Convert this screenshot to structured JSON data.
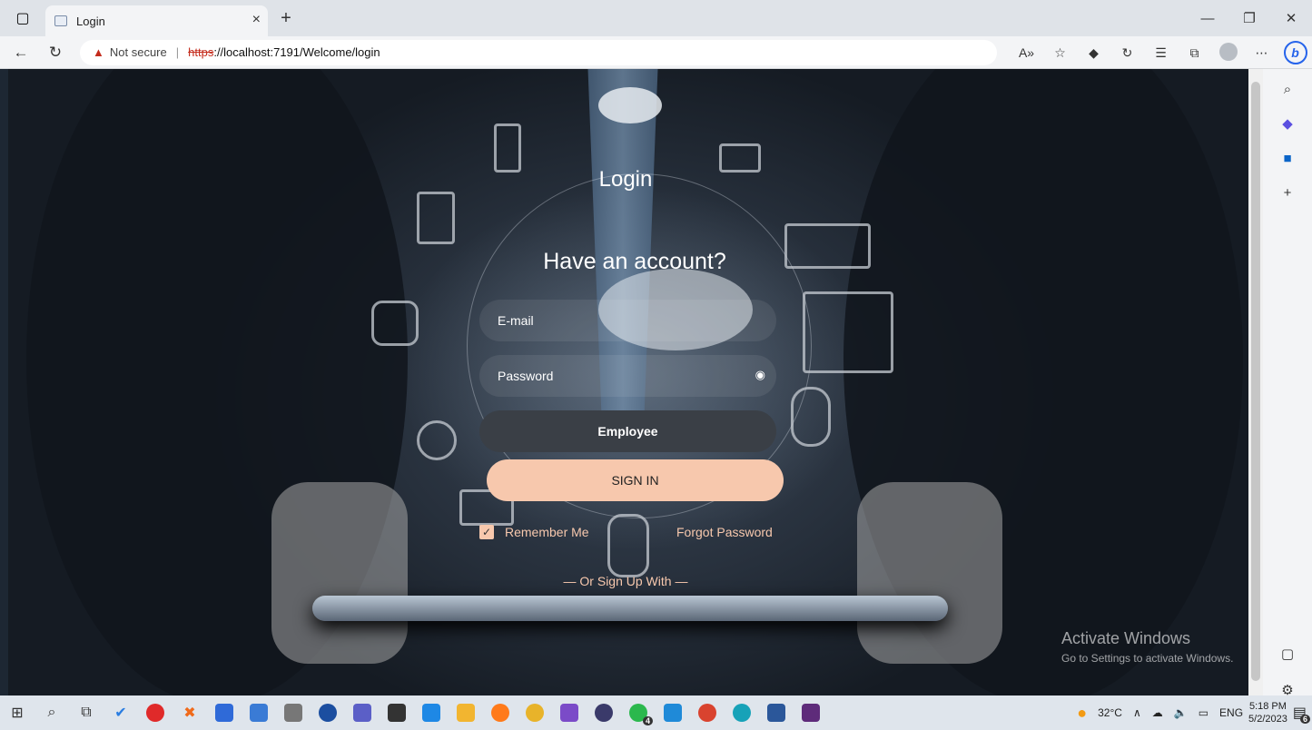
{
  "browser": {
    "tab_title": "Login",
    "new_tab_label": "+",
    "not_secure": "Not secure",
    "url_scheme": "https",
    "url_rest": "://localhost:7191/Welcome/login"
  },
  "login": {
    "title": "Login",
    "subtitle": "Have an account?",
    "email_placeholder": "E-mail",
    "password_placeholder": "Password",
    "role_button": "Employee",
    "sign_in": "SIGN IN",
    "remember_me": "Remember Me",
    "forgot_password": "Forgot Password",
    "or_sign_up": "— Or Sign Up With —"
  },
  "watermark": {
    "line1": "Activate Windows",
    "line2": "Go to Settings to activate Windows."
  },
  "taskbar": {
    "weather": "32°C",
    "language": "ENG",
    "time": "5:18 PM",
    "date": "5/2/2023",
    "whatsapp_badge": "4",
    "notification_badge": "6"
  },
  "colors": {
    "accent_peach": "#f7c8ad",
    "role_button_bg": "#3a3f46",
    "insecure_red": "#c42b1c"
  },
  "icons": {
    "email": "none",
    "password_toggle": "eye-icon",
    "remember": "checkbox-checked-icon"
  }
}
